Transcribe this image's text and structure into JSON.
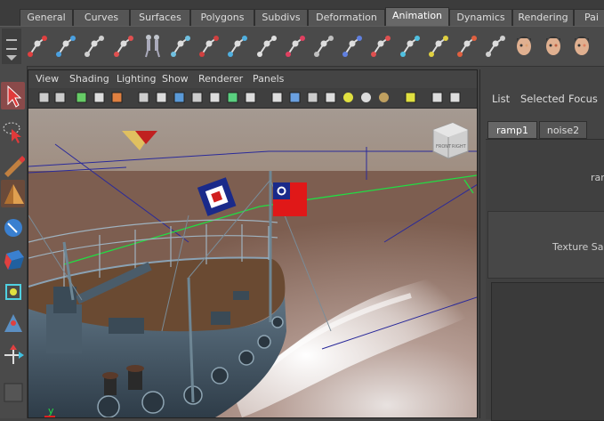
{
  "shelf_tabs": [
    "General",
    "Curves",
    "Surfaces",
    "Polygons",
    "Subdivs",
    "Deformation",
    "Animation",
    "Dynamics",
    "Rendering",
    "Pai"
  ],
  "active_shelf_tab": "Animation",
  "shelf_icons": [
    "set-key-icon",
    "bend-deformer-icon",
    "lattice-icon",
    "skeleton-joint-icon",
    "character-biped-icon",
    "ik-handle-icon",
    "joint-tool-icon",
    "insert-joint-icon",
    "mirror-joint-icon",
    "reroot-joint-icon",
    "orient-joint-icon",
    "bind-skin-icon",
    "ik-spline-icon",
    "connect-joint-icon",
    "remove-joint-icon",
    "aim-constraint-icon",
    "full-body-ik-icon",
    "blend-shape-face-icon",
    "wrinkle-face-icon",
    "paint-weights-face-icon"
  ],
  "toolbox": [
    "select-tool-icon",
    "lasso-tool-icon",
    "paint-select-icon",
    "move-tool-icon",
    "rotate-tool-icon",
    "scale-tool-icon",
    "manipulator-tool-icon",
    "soft-modify-icon",
    "show-manipulator-icon",
    "last-tool-icon"
  ],
  "viewport": {
    "menu": [
      "View",
      "Shading",
      "Lighting",
      "Show",
      "Renderer",
      "Panels"
    ],
    "view_cube_labels": [
      "FRONT",
      "RIGHT"
    ],
    "axis_label": "y"
  },
  "attribute_editor": {
    "menu": [
      "List",
      "Selected",
      "Focus"
    ],
    "tabs": [
      "ramp1",
      "noise2"
    ],
    "active_tab": "ramp1",
    "node_label": "ram",
    "section_label": "Texture Sam"
  },
  "colors": {
    "selection": "#22dd44",
    "flag_red": "#e01818",
    "flag_blue": "#1a2a8a"
  }
}
